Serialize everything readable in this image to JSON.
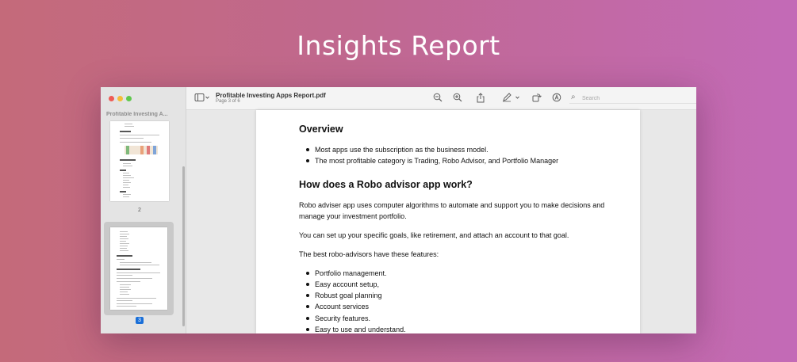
{
  "banner": {
    "title": "Insights Report"
  },
  "sidebar": {
    "title": "Profitable Investing A...",
    "pages": [
      {
        "number": "2"
      },
      {
        "number": "3",
        "selected": true
      }
    ]
  },
  "toolbar": {
    "doc_title": "Profitable Investing Apps Report.pdf",
    "page_indicator": "Page 3 of 6",
    "search_placeholder": "Search",
    "icons": [
      "sidebar-toggle-icon",
      "zoom-out-icon",
      "zoom-in-icon",
      "share-icon",
      "markup-pen-icon",
      "rotate-icon",
      "annotate-icon",
      "search-icon"
    ]
  },
  "document": {
    "overview_heading": "Overview",
    "overview_items": [
      "Most apps use the subscription as the business model.",
      "The most profitable category is Trading, Robo Advisor, and Portfolio Manager"
    ],
    "robo_heading": "How does a Robo advisor app work?",
    "para1": "Robo adviser app uses computer algorithms to automate and support you to make decisions and manage your investment portfolio.",
    "para2": "You can set up your specific goals, like retirement, and attach an account to that goal.",
    "para3": "The best robo-advisors have these features:",
    "features": [
      "Portfolio management.",
      "Easy account setup,",
      "Robust goal planning",
      "Account services",
      "Security features.",
      "Easy to use and understand."
    ]
  },
  "colors": {
    "accent": "#1a6fd8",
    "close": "#ee5c55",
    "minimize": "#f4bd3a",
    "zoom": "#5fc84d"
  }
}
